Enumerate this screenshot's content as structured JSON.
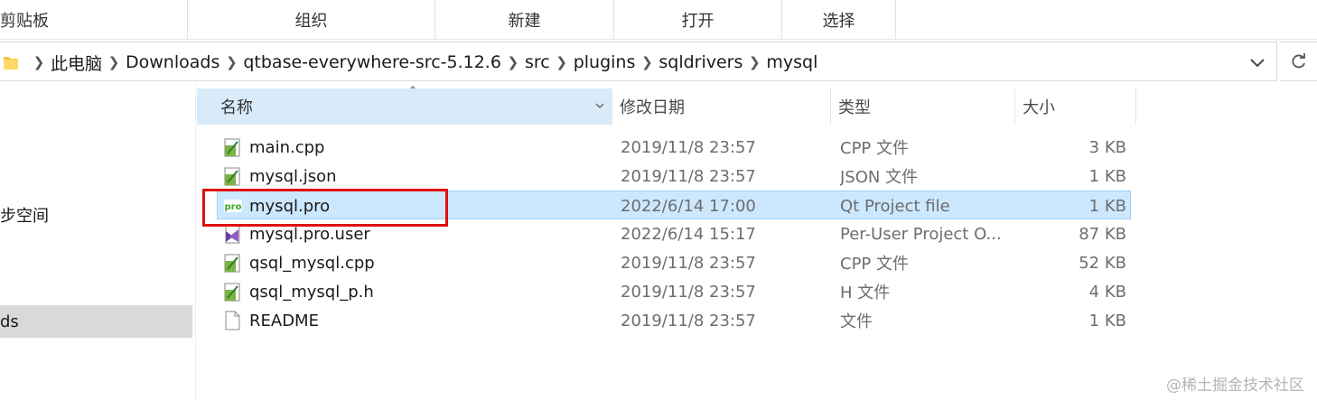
{
  "ribbon": {
    "groups": [
      "剪贴板",
      "组织",
      "新建",
      "打开",
      "选择"
    ]
  },
  "address": {
    "crumbs": [
      "此电脑",
      "Downloads",
      "qtbase-everywhere-src-5.12.6",
      "src",
      "plugins",
      "sqldrivers",
      "mysql"
    ]
  },
  "nav": {
    "items": [
      "步空间",
      "ds"
    ]
  },
  "columns": {
    "name": "名称",
    "date": "修改日期",
    "type": "类型",
    "size": "大小"
  },
  "files": [
    {
      "name": "main.cpp",
      "date": "2019/11/8 23:57",
      "type": "CPP 文件",
      "size": "3 KB",
      "icon": "cpp-file-icon"
    },
    {
      "name": "mysql.json",
      "date": "2019/11/8 23:57",
      "type": "JSON 文件",
      "size": "1 KB",
      "icon": "json-file-icon"
    },
    {
      "name": "mysql.pro",
      "date": "2022/6/14 17:00",
      "type": "Qt Project file",
      "size": "1 KB",
      "icon": "qt-pro-file-icon"
    },
    {
      "name": "mysql.pro.user",
      "date": "2022/6/14 15:17",
      "type": "Per-User Project O...",
      "size": "87 KB",
      "icon": "user-project-file-icon"
    },
    {
      "name": "qsql_mysql.cpp",
      "date": "2019/11/8 23:57",
      "type": "CPP 文件",
      "size": "52 KB",
      "icon": "cpp-file-icon"
    },
    {
      "name": "qsql_mysql_p.h",
      "date": "2019/11/8 23:57",
      "type": "H 文件",
      "size": "4 KB",
      "icon": "header-file-icon"
    },
    {
      "name": "README",
      "date": "2019/11/8 23:57",
      "type": "文件",
      "size": "1 KB",
      "icon": "blank-file-icon"
    }
  ],
  "watermark": "@稀土掘金技术社区",
  "colors": {
    "selection_bg": "#cce8ff",
    "selection_border": "#99d1ff",
    "highlight_box": "#e01010",
    "sorted_header_bg": "#d9ebf9"
  }
}
